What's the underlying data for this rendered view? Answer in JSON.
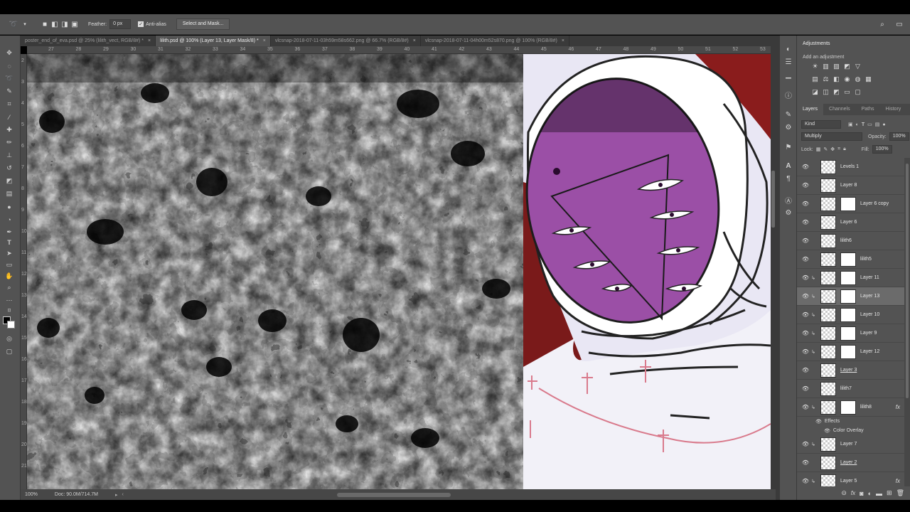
{
  "options_bar": {
    "feather_label": "Feather:",
    "feather_value": "0 px",
    "antialias_label": "Anti-alias",
    "antialias_checked": true,
    "select_mask_label": "Select and Mask..."
  },
  "tabs": [
    {
      "label": "poster_end_of_eva.psd @ 25% (lilith_vect, RGB/8#) *",
      "active": false
    },
    {
      "label": "lilith.psd @ 100% (Layer 13, Layer Mask/8) *",
      "active": true
    },
    {
      "label": "vlcsnap-2018-07-11-03h59m58s662.png @ 66.7% (RGB/8#)",
      "active": false
    },
    {
      "label": "vlcsnap-2018-07-11-04h00m52s870.png @ 100% (RGB/8#)",
      "active": false
    }
  ],
  "close_glyph": "×",
  "ruler_h": [
    "27",
    "28",
    "29",
    "30",
    "31",
    "32",
    "33",
    "34",
    "35",
    "36",
    "37",
    "38",
    "39",
    "40",
    "41",
    "42",
    "43",
    "44",
    "45",
    "46",
    "47",
    "48",
    "49",
    "50",
    "51",
    "52",
    "53"
  ],
  "ruler_v": [
    "2",
    "3",
    "4",
    "5",
    "6",
    "7",
    "8",
    "9",
    "10",
    "11",
    "12",
    "13",
    "14",
    "15",
    "16",
    "17",
    "18",
    "19",
    "20",
    "21"
  ],
  "status": {
    "zoom": "100%",
    "doc": "Doc: 90.0M/714.7M"
  },
  "adjustments": {
    "title": "Adjustments",
    "subtitle": "Add an adjustment"
  },
  "panel_tabs": [
    "Layers",
    "Channels",
    "Paths",
    "History"
  ],
  "layers_panel": {
    "kind_label": "Kind",
    "blend_mode": "Multiply",
    "opacity_label": "Opacity:",
    "opacity_value": "100%",
    "lock_label": "Lock:",
    "fill_label": "Fill:",
    "fill_value": "100%"
  },
  "layers": [
    {
      "name": "Levels 1",
      "mask": false,
      "selected": false,
      "clip": false,
      "fx": false,
      "underline": false
    },
    {
      "name": "Layer 8",
      "mask": false,
      "selected": false,
      "clip": false,
      "fx": false,
      "underline": false
    },
    {
      "name": "Layer 6 copy",
      "mask": true,
      "selected": false,
      "clip": false,
      "fx": false,
      "underline": false
    },
    {
      "name": "Layer 6",
      "mask": false,
      "selected": false,
      "clip": false,
      "fx": false,
      "underline": false
    },
    {
      "name": "lilith6",
      "mask": false,
      "selected": false,
      "clip": false,
      "fx": false,
      "underline": false
    },
    {
      "name": "lilith5",
      "mask": true,
      "selected": false,
      "clip": false,
      "fx": false,
      "underline": false
    },
    {
      "name": "Layer 11",
      "mask": true,
      "selected": false,
      "clip": true,
      "fx": false,
      "underline": false
    },
    {
      "name": "Layer 13",
      "mask": true,
      "selected": true,
      "clip": true,
      "fx": false,
      "underline": false
    },
    {
      "name": "Layer 10",
      "mask": true,
      "selected": false,
      "clip": true,
      "fx": false,
      "underline": false
    },
    {
      "name": "Layer 9",
      "mask": true,
      "selected": false,
      "clip": true,
      "fx": false,
      "underline": false
    },
    {
      "name": "Layer 12",
      "mask": true,
      "selected": false,
      "clip": true,
      "fx": false,
      "underline": false
    },
    {
      "name": "Layer 3",
      "mask": false,
      "selected": false,
      "clip": false,
      "fx": false,
      "underline": true
    },
    {
      "name": "lilith7",
      "mask": false,
      "selected": false,
      "clip": false,
      "fx": false,
      "underline": false
    },
    {
      "name": "lilith8",
      "mask": true,
      "selected": false,
      "clip": true,
      "fx": true,
      "underline": false
    },
    {
      "name": "Layer 7",
      "mask": false,
      "selected": false,
      "clip": true,
      "fx": false,
      "underline": false
    },
    {
      "name": "Layer 2",
      "mask": false,
      "selected": false,
      "clip": false,
      "fx": false,
      "underline": true
    },
    {
      "name": "Layer 5",
      "mask": false,
      "selected": false,
      "clip": true,
      "fx": true,
      "underline": false
    }
  ],
  "effects": {
    "label": "Effects",
    "color_overlay": "Color Overlay"
  },
  "fx_glyph": "fx",
  "colors": {
    "ui_dark": "#535353",
    "selection": "#6b6b6b",
    "visor_purple": "#9b4fa6",
    "backdrop_red": "#8a1c1c"
  }
}
